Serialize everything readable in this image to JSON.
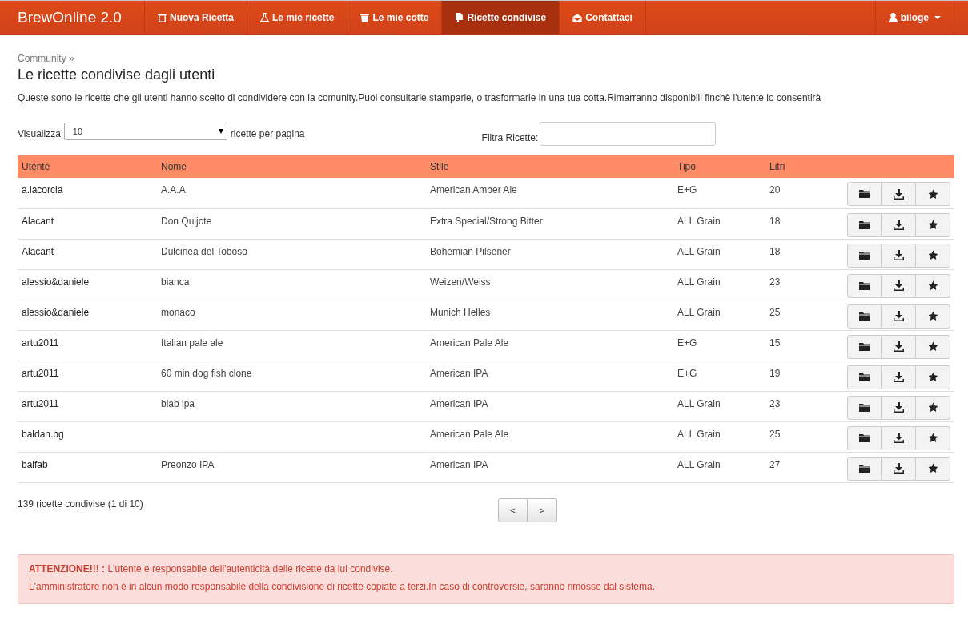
{
  "navbar": {
    "brand": "BrewOnline 2.0",
    "items": [
      {
        "kind": "new",
        "label": "Nuova Ricetta",
        "selected": false
      },
      {
        "kind": "flask",
        "label": "Le mie ricette",
        "selected": false
      },
      {
        "kind": "bucket",
        "label": "Le mie cotte",
        "selected": false
      },
      {
        "kind": "document",
        "label": "Ricette condivise",
        "selected": true
      },
      {
        "kind": "mail",
        "label": "Contattaci",
        "selected": false
      }
    ],
    "user": "biloge"
  },
  "breadcrumb": "Community »",
  "title": "Le ricette condivise dagli utenti",
  "intro": "Queste sono le ricette che gli utenti hanno scelto di condividere con la comunity.Puoi consultarle,stamparle, o trasformarle in una tua cotta.Rimarranno disponibili finchè l'utente lo consentirà",
  "page_size": {
    "label": "Visualizza",
    "value": "10",
    "suffix": "ricette per pagina"
  },
  "filter": {
    "label": "Filtra Ricette:"
  },
  "table": {
    "columns": [
      "Utente",
      "Nome",
      "Stile",
      "Tipo",
      "Litri"
    ],
    "rows": [
      {
        "utente": "a.lacorcia",
        "nome": "A.A.A.",
        "stile": "American Amber Ale",
        "tipo": "E+G",
        "litri": "20"
      },
      {
        "utente": "Alacant",
        "nome": "Don Quijote",
        "stile": "Extra Special/Strong Bitter",
        "tipo": "ALL Grain",
        "litri": "18"
      },
      {
        "utente": "Alacant",
        "nome": "Dulcinea del Toboso",
        "stile": "Bohemian Pilsener",
        "tipo": "ALL Grain",
        "litri": "18"
      },
      {
        "utente": "alessio&daniele",
        "nome": "bianca",
        "stile": "Weizen/Weiss",
        "tipo": "ALL Grain",
        "litri": "23"
      },
      {
        "utente": "alessio&daniele",
        "nome": "monaco",
        "stile": "Munich Helles",
        "tipo": "ALL Grain",
        "litri": "25"
      },
      {
        "utente": "artu2011",
        "nome": "Italian pale ale",
        "stile": "American Pale Ale",
        "tipo": "E+G",
        "litri": "15"
      },
      {
        "utente": "artu2011",
        "nome": "60 min dog fish clone",
        "stile": "American IPA",
        "tipo": "E+G",
        "litri": "19"
      },
      {
        "utente": "artu2011",
        "nome": "biab ipa",
        "stile": "American IPA",
        "tipo": "ALL Grain",
        "litri": "23"
      },
      {
        "utente": "baldan.bg",
        "stile": "American Pale Ale",
        "tipo": "ALL Grain",
        "litri": "25"
      },
      {
        "utente": "balfab",
        "nome": "Preonzo IPA",
        "stile": "American IPA",
        "tipo": "ALL Grain",
        "litri": "27"
      }
    ]
  },
  "summary": "139 ricette condivise (1 di 10)",
  "pager": {
    "prev": "<",
    "next": ">"
  },
  "alert": [
    "**ATTENZIONE!!! :** L'utente e responsabile dell'autenticità  delle ricette da lui condivise.",
    "L'amministratore non è in alcun modo responsabile della condivisione di ricette copiate a terzi.In caso di controversie, saranno rimosse dal sistema."
  ]
}
